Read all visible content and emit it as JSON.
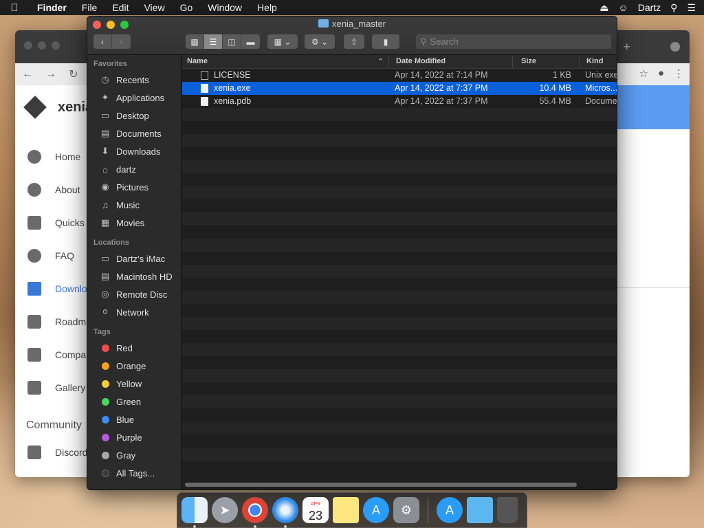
{
  "menubar": {
    "app": "Finder",
    "items": [
      "File",
      "Edit",
      "View",
      "Go",
      "Window",
      "Help"
    ],
    "user": "Dartz"
  },
  "browser": {
    "site_title": "xenia",
    "nav": [
      {
        "label": "Home",
        "icon": "home-icon"
      },
      {
        "label": "About",
        "icon": "info-icon"
      },
      {
        "label": "Quicks",
        "icon": "clipboard-icon"
      },
      {
        "label": "FAQ",
        "icon": "help-icon"
      },
      {
        "label": "Downlo",
        "icon": "download-icon",
        "active": true
      },
      {
        "label": "Roadm",
        "icon": "calendar-icon"
      },
      {
        "label": "Compa",
        "icon": "chart-icon"
      },
      {
        "label": "Gallery",
        "icon": "gallery-icon"
      }
    ],
    "community_heading": "Community",
    "discord_label": "Discord"
  },
  "finder": {
    "title": "xenia_master",
    "search_placeholder": "Search",
    "sidebar": {
      "favorites_heading": "Favorites",
      "favorites": [
        {
          "label": "Recents",
          "icon": "clock-icon"
        },
        {
          "label": "Applications",
          "icon": "applications-icon"
        },
        {
          "label": "Desktop",
          "icon": "desktop-icon"
        },
        {
          "label": "Documents",
          "icon": "document-icon"
        },
        {
          "label": "Downloads",
          "icon": "download-icon"
        },
        {
          "label": "dartz",
          "icon": "home-icon"
        },
        {
          "label": "Pictures",
          "icon": "camera-icon"
        },
        {
          "label": "Music",
          "icon": "music-icon"
        },
        {
          "label": "Movies",
          "icon": "film-icon"
        }
      ],
      "locations_heading": "Locations",
      "locations": [
        {
          "label": "Dartz’s iMac",
          "icon": "monitor-icon"
        },
        {
          "label": "Macintosh HD",
          "icon": "drive-icon"
        },
        {
          "label": "Remote Disc",
          "icon": "disc-icon"
        },
        {
          "label": "Network",
          "icon": "globe-icon"
        }
      ],
      "tags_heading": "Tags",
      "tags": [
        {
          "label": "Red",
          "color": "#ee4d4d"
        },
        {
          "label": "Orange",
          "color": "#f4a125"
        },
        {
          "label": "Yellow",
          "color": "#f3d032"
        },
        {
          "label": "Green",
          "color": "#4dd55e"
        },
        {
          "label": "Blue",
          "color": "#3d8ef0"
        },
        {
          "label": "Purple",
          "color": "#b35adf"
        },
        {
          "label": "Gray",
          "color": "#a8a8a8"
        },
        {
          "label": "All Tags...",
          "color": "#3b3b3b"
        }
      ]
    },
    "columns": {
      "name": "Name",
      "date": "Date Modified",
      "size": "Size",
      "kind": "Kind"
    },
    "files": [
      {
        "name": "LICENSE",
        "date": "Apr 14, 2022 at 7:14 PM",
        "size": "1 KB",
        "kind": "Unix exe",
        "icon": "terminal-file-icon"
      },
      {
        "name": "xenia.exe",
        "date": "Apr 14, 2022 at 7:37 PM",
        "size": "10.4 MB",
        "kind": "Micros...",
        "icon": "file-icon",
        "selected": true
      },
      {
        "name": "xenia.pdb",
        "date": "Apr 14, 2022 at 7:37 PM",
        "size": "55.4 MB",
        "kind": "Docume",
        "icon": "file-icon"
      }
    ]
  },
  "dock": {
    "apps": [
      "Finder",
      "Launchpad",
      "Chrome",
      "Safari",
      "Calendar",
      "Notes",
      "App Store",
      "System Preferences",
      "App Store Downloads",
      "Downloads Folder",
      "Trash"
    ],
    "calendar_month": "APR",
    "calendar_day": "23"
  }
}
